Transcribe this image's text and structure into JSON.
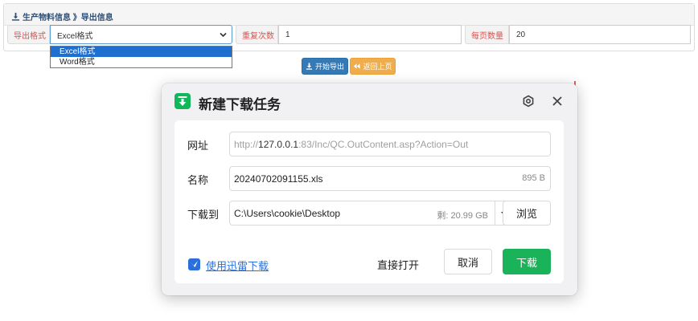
{
  "breadcrumb": {
    "icon": "download-icon",
    "text": "生产物料信息 》导出信息"
  },
  "form": {
    "format_label": "导出格式",
    "format_value": "Excel格式",
    "format_options": [
      "Excel格式",
      "Word格式"
    ],
    "repeat_label": "重复次数",
    "repeat_value": "1",
    "pagesize_label": "每页数量",
    "pagesize_value": "20"
  },
  "actions": {
    "export_label": "开始导出",
    "back_label": "返回上页"
  },
  "dialog": {
    "title": "新建下载任务",
    "url_label": "网址",
    "url_prefix": "http://",
    "url_host": "127.0.0.1",
    "url_rest": ":83/Inc/QC.OutContent.asp?Action=Out",
    "name_label": "名称",
    "file_name": "20240702091155.xls",
    "file_size": "895 B",
    "path_label": "下载到",
    "path_value": "C:\\Users\\cookie\\Desktop",
    "free_space": "剩: 20.99 GB",
    "browse_label": "浏览",
    "thunder_label": "使用迅雷下载",
    "open_label": "直接打开",
    "cancel_label": "取消",
    "download_label": "下载"
  },
  "colors": {
    "primary": "#337ab7",
    "warning": "#f0ad4e",
    "label_red": "#d9534f",
    "download_green": "#1bb35a",
    "link_blue": "#2a6fdb"
  }
}
